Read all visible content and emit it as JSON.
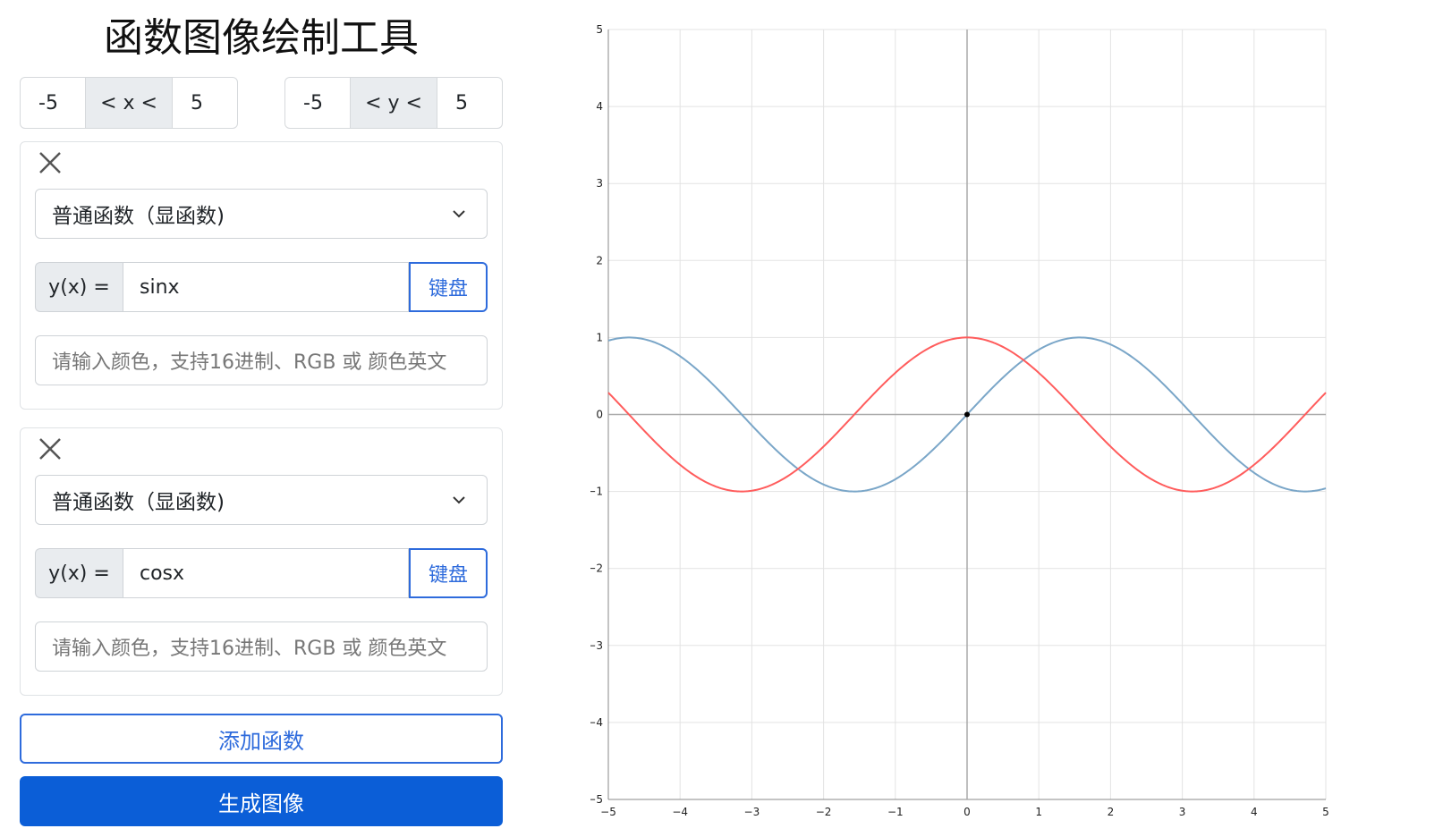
{
  "title": "函数图像绘制工具",
  "x_range": {
    "min": "-5",
    "label": "< x <",
    "max": "5"
  },
  "y_range": {
    "min": "-5",
    "label": "< y <",
    "max": "5"
  },
  "functions": [
    {
      "type": "普通函数（显函数)",
      "prefix": "y(x) =",
      "expression": "sinx",
      "keyboard": "键盘",
      "color_placeholder": "请输入颜色，支持16进制、RGB 或 颜色英文"
    },
    {
      "type": "普通函数（显函数)",
      "prefix": "y(x) =",
      "expression": "cosx",
      "keyboard": "键盘",
      "color_placeholder": "请输入颜色，支持16进制、RGB 或 颜色英文"
    }
  ],
  "add_button": "添加函数",
  "generate_button": "生成图像",
  "chart_data": {
    "type": "line",
    "xlim": [
      -5,
      5
    ],
    "ylim": [
      -5,
      5
    ],
    "x_ticks": [
      "−5",
      "−4",
      "−3",
      "−2",
      "−1",
      "0",
      "1",
      "2",
      "3",
      "4",
      "5"
    ],
    "y_ticks": [
      "−5",
      "−4",
      "−3",
      "−2",
      "−1",
      "0",
      "1",
      "2",
      "3",
      "4",
      "5"
    ],
    "grid": true,
    "series": [
      {
        "expression": "sinx",
        "color": "#7aa6c8"
      },
      {
        "expression": "cosx",
        "color": "#ff5c5c"
      }
    ],
    "points": [
      {
        "x": 0,
        "y": 0
      }
    ]
  }
}
